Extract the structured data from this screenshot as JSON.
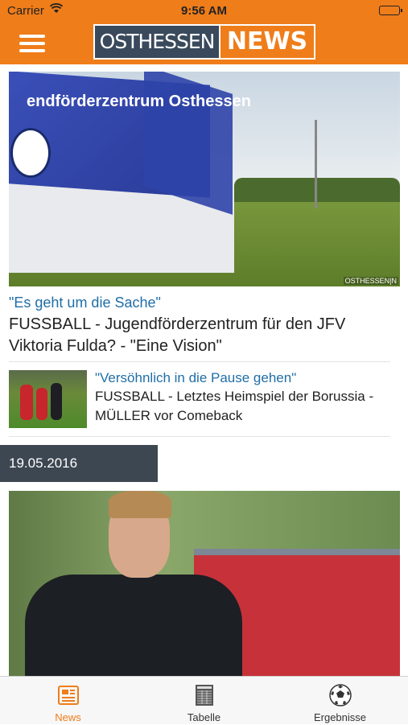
{
  "status_bar": {
    "carrier": "Carrier",
    "time": "9:56 AM"
  },
  "header": {
    "logo_left": "OSTHESSEN",
    "logo_right": "NEWS"
  },
  "articles": [
    {
      "kicker": "\"Es geht um die Sache\"",
      "headline": "FUSSBALL - Jugendförderzentrum für den JFV Viktoria Fulda? - \"Eine Vision\"",
      "image_sign": "endförderzentrum Osthessen",
      "image_watermark": "OSTHESSEN|N"
    },
    {
      "kicker": "\"Versöhnlich in die Pause gehen\"",
      "headline": "FUSSBALL - Letztes Heimspiel der Borussia - MÜLLER vor Comeback"
    }
  ],
  "date_section": "19.05.2016",
  "tabs": [
    {
      "label": "News",
      "icon": "newspaper-icon",
      "active": true
    },
    {
      "label": "Tabelle",
      "icon": "table-icon",
      "active": false
    },
    {
      "label": "Ergebnisse",
      "icon": "soccer-ball-icon",
      "active": false
    }
  ],
  "colors": {
    "brand_orange": "#ef7d1a",
    "navy": "#3a4a5c",
    "link_blue": "#1f6ea7",
    "date_bar": "#3d4752"
  }
}
